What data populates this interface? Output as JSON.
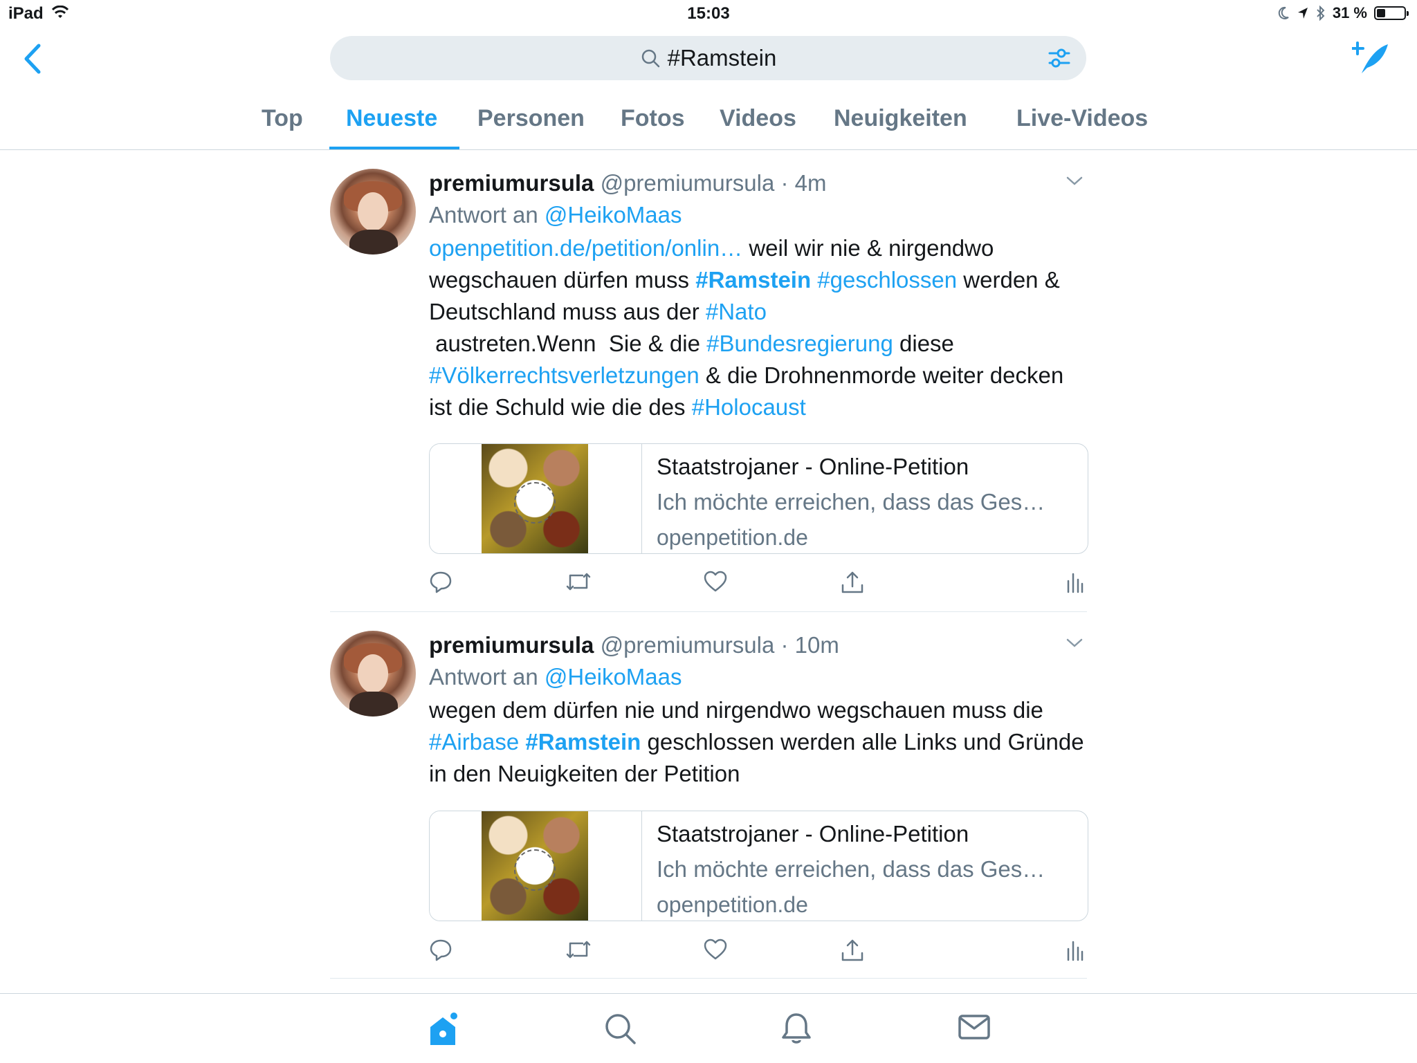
{
  "status_bar": {
    "device": "iPad",
    "time": "15:03",
    "battery_text": "31 %",
    "battery_level": 0.31
  },
  "search": {
    "query": "#Ramstein"
  },
  "tabs": [
    {
      "label": "Top",
      "active": false
    },
    {
      "label": "Neueste",
      "active": true
    },
    {
      "label": "Personen",
      "active": false
    },
    {
      "label": "Fotos",
      "active": false
    },
    {
      "label": "Videos",
      "active": false
    },
    {
      "label": "Neuigkeiten",
      "active": false
    },
    {
      "label": "Live-Videos",
      "active": false
    }
  ],
  "tweets": [
    {
      "name": "premiumursula",
      "handle": "@premiumursula",
      "separator": "·",
      "time": "4m",
      "reply_prefix": "Antwort an",
      "reply_to": "@HeikoMaas",
      "card": {
        "title": "Staatstrojaner - Online-Petition",
        "description": "Ich möchte erreichen, dass das Ges…",
        "domain": "openpetition.de"
      }
    },
    {
      "name": "premiumursula",
      "handle": "@premiumursula",
      "separator": "·",
      "time": "10m",
      "reply_prefix": "Antwort an",
      "reply_to": "@HeikoMaas",
      "card": {
        "title": "Staatstrojaner - Online-Petition",
        "description": "Ich möchte erreichen, dass das Ges…",
        "domain": "openpetition.de"
      }
    }
  ],
  "tweet_text_1": {
    "link": "openpetition.de/petition/onlin…",
    "t1": " weil wir nie & nirgendwo wegschauen dürfen muss ",
    "h_ramstein": "#Ramstein",
    "sp1": " ",
    "h_geschlossen": "#geschlossen",
    "t2": " werden & Deutschland muss aus der ",
    "h_nato": "#Nato",
    "t3": " austreten.Wenn  Sie & die ",
    "h_bund": "#Bundesregierung",
    "t4": " diese ",
    "h_voelker": "#Völkerrechtsverletzungen",
    "t5": " & die Drohnenmorde weiter decken ist die Schuld wie die des ",
    "h_holo": "#Holocaust"
  },
  "tweet_text_2": {
    "t1": "wegen dem dürfen nie und nirgendwo wegschauen muss die ",
    "h_airbase": "#Airbase",
    "sp1": " ",
    "h_ramstein": "#Ramstein",
    "t2": " geschlossen werden alle Links und Gründe in den Neuigkeiten der Petition"
  },
  "icons": {
    "back": "chevron-left-icon",
    "search": "search-icon",
    "filter": "filter-sliders-icon",
    "compose": "compose-feather-icon",
    "reply": "reply-bubble-icon",
    "retweet": "retweet-icon",
    "like": "heart-icon",
    "share": "share-icon",
    "analytics": "analytics-bars-icon",
    "more": "chevron-down-icon",
    "home": "home-icon",
    "explore": "search-icon",
    "notifications": "bell-icon",
    "messages": "envelope-icon"
  },
  "colors": {
    "accent": "#1da1f2",
    "secondary_text": "#657786",
    "search_bg": "#e6ecf0"
  }
}
